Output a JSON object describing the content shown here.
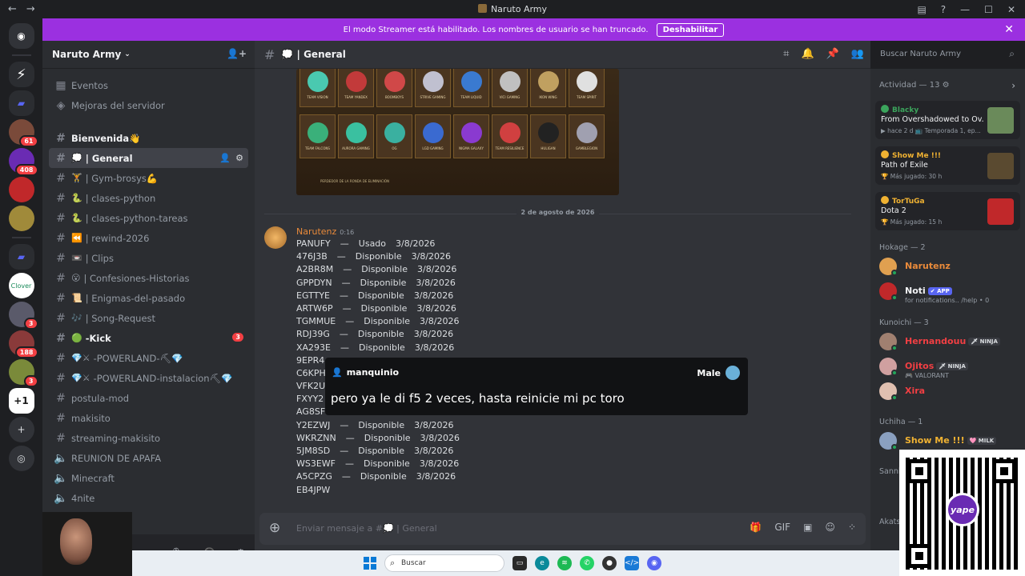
{
  "window": {
    "title": "Naruto Army",
    "nav_back": "←",
    "nav_fwd": "→",
    "btn_minimize": "—",
    "btn_maximize": "☐",
    "btn_close": "✕"
  },
  "banner": {
    "text": "El modo Streamer está habilitado. Los nombres de usuario se han truncado.",
    "button": "Deshabilitar",
    "close": "✕"
  },
  "rail": {
    "badges": [
      "61",
      "408",
      "3",
      "188",
      "3"
    ]
  },
  "server": {
    "name": "Naruto Army"
  },
  "channels": {
    "top": [
      {
        "icon": "calendar-icon",
        "label": "Eventos"
      },
      {
        "icon": "boost-icon",
        "label": "Mejoras del servidor"
      }
    ],
    "items": [
      {
        "emoji": "",
        "label": "Bienvenida👋",
        "style": "bold"
      },
      {
        "emoji": "💭",
        "label": "| General",
        "style": "active"
      },
      {
        "emoji": "🏋",
        "label": "| Gym-brosys💪",
        "style": "normal"
      },
      {
        "emoji": "🐍",
        "label": "| clases-python",
        "style": "normal"
      },
      {
        "emoji": "🐍",
        "label": "| clases-python-tareas",
        "style": "normal"
      },
      {
        "emoji": "⏪",
        "label": "| rewind-2026",
        "style": "normal"
      },
      {
        "emoji": "📼",
        "label": "| Clips",
        "style": "normal"
      },
      {
        "emoji": "😮",
        "label": "| Confesiones-Historias",
        "style": "normal"
      },
      {
        "emoji": "📜",
        "label": "| Enigmas-del-pasado",
        "style": "normal"
      },
      {
        "emoji": "🎶",
        "label": "| Song-Request",
        "style": "normal"
      },
      {
        "emoji": "🟢",
        "label": "-Kick",
        "style": "bold",
        "badge": "3"
      },
      {
        "emoji": "💎⚔",
        "label": "-POWERLAND-⛏💎",
        "style": "normal"
      },
      {
        "emoji": "💎⚔",
        "label": "-POWERLAND-instalacion⛏💎",
        "style": "normal"
      },
      {
        "emoji": "",
        "label": "postula-mod",
        "style": "normal"
      },
      {
        "emoji": "",
        "label": "makisito",
        "style": "normal"
      },
      {
        "emoji": "",
        "label": "streaming-makisito",
        "style": "normal"
      },
      {
        "emoji": "🔊",
        "label": "REUNION DE APAFA",
        "style": "voice"
      },
      {
        "emoji": "🔊",
        "label": "Minecraft",
        "style": "voice"
      },
      {
        "emoji": "🔊",
        "label": "4nite",
        "style": "voice"
      }
    ]
  },
  "chat": {
    "channel_name": "💭 | General",
    "date_separator": "2 de agosto de 2026",
    "embed_teams": [
      [
        "TEAM VISION",
        "TEAM YANDEX",
        "BOOMBOYS",
        "STRIVE GAMING",
        "TEAM LIQUID",
        "VICI GAMING",
        "IKON WING",
        "TEAM SPIRIT"
      ],
      [
        "TEAM FALCONS",
        "AURORA GAMING",
        "OG",
        "LGD GAMING",
        "NIGMA GALAXY",
        "TEAM RESILIENCE",
        "HULIGAN",
        "GAMBLEGION"
      ]
    ],
    "embed_footer": "PERDEDOR DE LA RONDA DE ELIMINACIÓN",
    "message": {
      "author": "Narutenz",
      "time": "0:16",
      "lines": [
        {
          "code": "PANUFY",
          "status": "Usado",
          "date": "3/8/2026"
        },
        {
          "code": "476J3B",
          "status": "Disponible",
          "date": "3/8/2026"
        },
        {
          "code": "A2BR8M",
          "status": "Disponible",
          "date": "3/8/2026"
        },
        {
          "code": "GPPDYN",
          "status": "Disponible",
          "date": "3/8/2026"
        },
        {
          "code": "EGTTYE",
          "status": "Disponible",
          "date": "3/8/2026"
        },
        {
          "code": "ARTW6P",
          "status": "Disponible",
          "date": "3/8/2026"
        },
        {
          "code": "TGMMUE",
          "status": "Disponible",
          "date": "3/8/2026"
        },
        {
          "code": "RDJ39G",
          "status": "Disponible",
          "date": "3/8/2026"
        },
        {
          "code": "XA293E",
          "status": "Disponible",
          "date": "3/8/2026"
        },
        {
          "code": "9EPR4",
          "status": "",
          "date": ""
        },
        {
          "code": "C6KPH",
          "status": "",
          "date": ""
        },
        {
          "code": "VFK2U",
          "status": "",
          "date": ""
        },
        {
          "code": "FXYY2",
          "status": "",
          "date": ""
        },
        {
          "code": "AG8SF",
          "status": "",
          "date": ""
        },
        {
          "code": "Y2EZWJ",
          "status": "Disponible",
          "date": "3/8/2026"
        },
        {
          "code": "WKRZNN",
          "status": "Disponible",
          "date": "3/8/2026"
        },
        {
          "code": "5JM8SD",
          "status": "Disponible",
          "date": "3/8/2026"
        },
        {
          "code": "WS3EWF",
          "status": "Disponible",
          "date": "3/8/2026"
        },
        {
          "code": "A5CPZG",
          "status": "Disponible",
          "date": "3/8/2026"
        },
        {
          "code": "EB4JPW",
          "status": "",
          "date": ""
        }
      ]
    },
    "composer_placeholder": "Enviar mensaje a #💭 | General"
  },
  "overlay": {
    "user": "manquinio",
    "right_label": "Male",
    "text": "pero ya le di f5 2 veces, hasta reinicie mi pc toro"
  },
  "search": {
    "placeholder": "Buscar Naruto Army"
  },
  "members": {
    "activity_title": "Actividad — 13 ⚙",
    "activities": [
      {
        "user": "Blacky",
        "user_color": "#3ba55c",
        "title": "From Overshadowed to Ov...",
        "meta": "▶ hace 2 d   📺 Temporada 1, ep...",
        "thumb": "#6a8a5a"
      },
      {
        "user": "Show Me !!!",
        "user_color": "#f0b232",
        "title": "Path of Exile",
        "meta": "🏆 Más jugado: 30 h",
        "thumb": "#5a4a30"
      },
      {
        "user": "TorTuGa",
        "user_color": "#f0b232",
        "title": "Dota 2",
        "meta": "🏆 Más jugado: 15 h",
        "thumb": "#c0282a"
      }
    ],
    "groups": [
      {
        "title": "Hokage — 2",
        "members": [
          {
            "name": "Narutenz",
            "color": "#e98a3a",
            "tag": "",
            "sub": ""
          },
          {
            "name": "Noti",
            "color": "#f2f3f5",
            "tag": "✔ APP",
            "sub": "for notifications.. /help • 0"
          }
        ]
      },
      {
        "title": "Kunoichi — 3",
        "members": [
          {
            "name": "Hernandouu",
            "color": "#f23f43",
            "tag": "🗡 NINJA",
            "sub": ""
          },
          {
            "name": "Ojitos",
            "color": "#f23f43",
            "tag": "🗡 NINJA",
            "sub": "🎮 VALORANT"
          },
          {
            "name": "Xira",
            "color": "#f23f43",
            "tag": "",
            "sub": ""
          }
        ]
      },
      {
        "title": "Uchiha — 1",
        "members": [
          {
            "name": "Show Me !!!",
            "color": "#f0b232",
            "tag": "🩷 MILK",
            "sub": ""
          }
        ]
      }
    ],
    "partial_groups": [
      "Sanni",
      "Akats"
    ]
  },
  "qr": {
    "brand": "yape"
  },
  "taskbar": {
    "search": "Buscar"
  }
}
